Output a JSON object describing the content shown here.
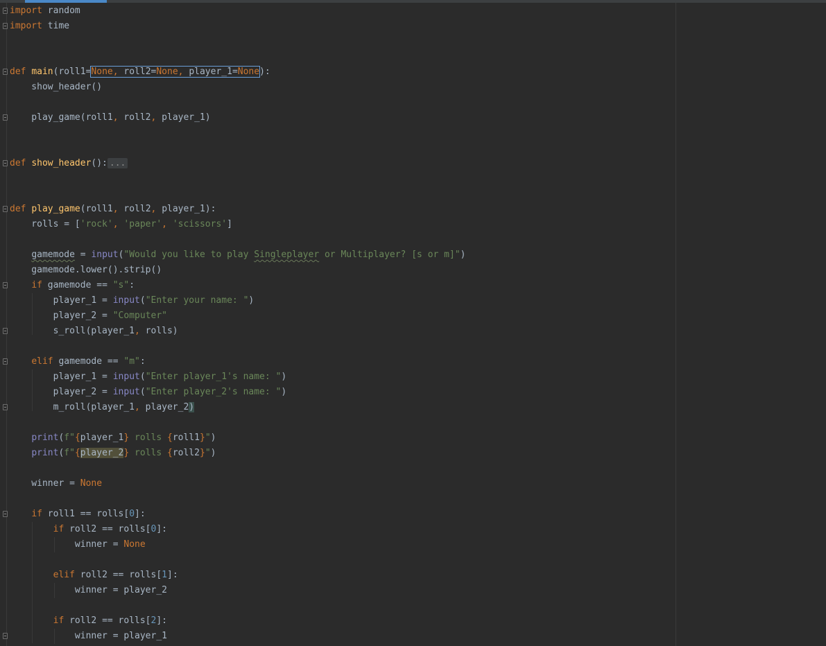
{
  "editor": {
    "lines": [
      [
        {
          "t": "import",
          "c": "kw"
        },
        {
          "t": " random"
        }
      ],
      [
        {
          "t": "import",
          "c": "kw"
        },
        {
          "t": " time"
        }
      ],
      [],
      [],
      [
        {
          "t": "def ",
          "c": "kw"
        },
        {
          "t": "main",
          "c": "fn"
        },
        {
          "t": "(roll1="
        },
        {
          "t": "None",
          "c": "kw",
          "box": "start"
        },
        {
          "t": ", ",
          "c": "kw",
          "box": "mid"
        },
        {
          "t": "roll2=",
          "box": "mid"
        },
        {
          "t": "None",
          "c": "kw",
          "box": "mid"
        },
        {
          "t": ", ",
          "c": "kw",
          "box": "mid"
        },
        {
          "t": "player_1=",
          "box": "mid"
        },
        {
          "t": "None",
          "c": "kw",
          "box": "end"
        },
        {
          "t": "):"
        }
      ],
      [
        {
          "t": "    show_header()"
        }
      ],
      [],
      [
        {
          "t": "    play_game(roll1"
        },
        {
          "t": ", ",
          "c": "kw"
        },
        {
          "t": "roll2"
        },
        {
          "t": ", ",
          "c": "kw"
        },
        {
          "t": "player_1)"
        }
      ],
      [],
      [],
      [
        {
          "t": "def ",
          "c": "kw"
        },
        {
          "t": "show_header",
          "c": "fn"
        },
        {
          "t": "():"
        },
        {
          "t": "...",
          "c": "folded"
        }
      ],
      [],
      [],
      [
        {
          "t": "def ",
          "c": "kw"
        },
        {
          "t": "play_game",
          "c": "fn"
        },
        {
          "t": "(roll1"
        },
        {
          "t": ", ",
          "c": "kw"
        },
        {
          "t": "roll2"
        },
        {
          "t": ", ",
          "c": "kw"
        },
        {
          "t": "player_1):"
        }
      ],
      [
        {
          "t": "    rolls = ["
        },
        {
          "t": "'rock'",
          "c": "str"
        },
        {
          "t": ", ",
          "c": "kw"
        },
        {
          "t": "'paper'",
          "c": "str"
        },
        {
          "t": ", ",
          "c": "kw"
        },
        {
          "t": "'scissors'",
          "c": "str"
        },
        {
          "t": "]"
        }
      ],
      [],
      [
        {
          "t": "    "
        },
        {
          "t": "gamemode",
          "c": "warn"
        },
        {
          "t": " = "
        },
        {
          "t": "input",
          "c": "bi"
        },
        {
          "t": "("
        },
        {
          "t": "\"Would you like to play ",
          "c": "str"
        },
        {
          "t": "Singleplayer",
          "c": "str warn"
        },
        {
          "t": " or Multiplayer? [s or m]\"",
          "c": "str"
        },
        {
          "t": ")"
        }
      ],
      [
        {
          "t": "    gamemode.lower().strip()"
        }
      ],
      [
        {
          "t": "    "
        },
        {
          "t": "if ",
          "c": "kw"
        },
        {
          "t": "gamemode == "
        },
        {
          "t": "\"s\"",
          "c": "str"
        },
        {
          "t": ":"
        }
      ],
      [
        {
          "t": "        player_1 = "
        },
        {
          "t": "input",
          "c": "bi"
        },
        {
          "t": "("
        },
        {
          "t": "\"Enter your name: \"",
          "c": "str"
        },
        {
          "t": ")"
        }
      ],
      [
        {
          "t": "        player_2 = "
        },
        {
          "t": "\"Computer\"",
          "c": "str"
        }
      ],
      [
        {
          "t": "        s_roll(player_1"
        },
        {
          "t": ", ",
          "c": "kw"
        },
        {
          "t": "rolls)"
        }
      ],
      [],
      [
        {
          "t": "    "
        },
        {
          "t": "elif ",
          "c": "kw"
        },
        {
          "t": "gamemode == "
        },
        {
          "t": "\"m\"",
          "c": "str"
        },
        {
          "t": ":"
        }
      ],
      [
        {
          "t": "        player_1 = "
        },
        {
          "t": "input",
          "c": "bi"
        },
        {
          "t": "("
        },
        {
          "t": "\"Enter player_1's name: \"",
          "c": "str"
        },
        {
          "t": ")"
        }
      ],
      [
        {
          "t": "        player_2 = "
        },
        {
          "t": "input",
          "c": "bi"
        },
        {
          "t": "("
        },
        {
          "t": "\"Enter player_2's name: \"",
          "c": "str"
        },
        {
          "t": ")"
        }
      ],
      [
        {
          "t": "        m_roll(player_1"
        },
        {
          "t": ", ",
          "c": "kw"
        },
        {
          "t": "player_2"
        },
        {
          "t": ")",
          "c": "brace-match"
        }
      ],
      [],
      [
        {
          "t": "    "
        },
        {
          "t": "print",
          "c": "bi"
        },
        {
          "t": "("
        },
        {
          "t": "f\"",
          "c": "str"
        },
        {
          "t": "{",
          "c": "kw"
        },
        {
          "t": "player_1"
        },
        {
          "t": "}",
          "c": "kw"
        },
        {
          "t": " rolls ",
          "c": "str"
        },
        {
          "t": "{",
          "c": "kw"
        },
        {
          "t": "roll1"
        },
        {
          "t": "}",
          "c": "kw"
        },
        {
          "t": "\"",
          "c": "str"
        },
        {
          "t": ")"
        }
      ],
      [
        {
          "t": "    "
        },
        {
          "t": "print",
          "c": "bi"
        },
        {
          "t": "("
        },
        {
          "t": "f\"",
          "c": "str"
        },
        {
          "t": "{",
          "c": "kw"
        },
        {
          "t": "player_2",
          "c": "hl-ident"
        },
        {
          "t": "}",
          "c": "kw"
        },
        {
          "t": " rolls ",
          "c": "str"
        },
        {
          "t": "{",
          "c": "kw"
        },
        {
          "t": "roll2"
        },
        {
          "t": "}",
          "c": "kw"
        },
        {
          "t": "\"",
          "c": "str"
        },
        {
          "t": ")"
        }
      ],
      [],
      [
        {
          "t": "    winner = "
        },
        {
          "t": "None",
          "c": "kw"
        }
      ],
      [],
      [
        {
          "t": "    "
        },
        {
          "t": "if ",
          "c": "kw"
        },
        {
          "t": "roll1 == rolls["
        },
        {
          "t": "0",
          "c": "num"
        },
        {
          "t": "]:"
        }
      ],
      [
        {
          "t": "        "
        },
        {
          "t": "if ",
          "c": "kw"
        },
        {
          "t": "roll2 == rolls["
        },
        {
          "t": "0",
          "c": "num"
        },
        {
          "t": "]:"
        }
      ],
      [
        {
          "t": "            winner = "
        },
        {
          "t": "None",
          "c": "kw"
        }
      ],
      [],
      [
        {
          "t": "        "
        },
        {
          "t": "elif ",
          "c": "kw"
        },
        {
          "t": "roll2 == rolls["
        },
        {
          "t": "1",
          "c": "num"
        },
        {
          "t": "]:"
        }
      ],
      [
        {
          "t": "            winner = player_2"
        }
      ],
      [],
      [
        {
          "t": "        "
        },
        {
          "t": "if ",
          "c": "kw"
        },
        {
          "t": "roll2 == rolls["
        },
        {
          "t": "2",
          "c": "num"
        },
        {
          "t": "]:"
        }
      ],
      [
        {
          "t": "            winner = player_1"
        }
      ]
    ]
  }
}
